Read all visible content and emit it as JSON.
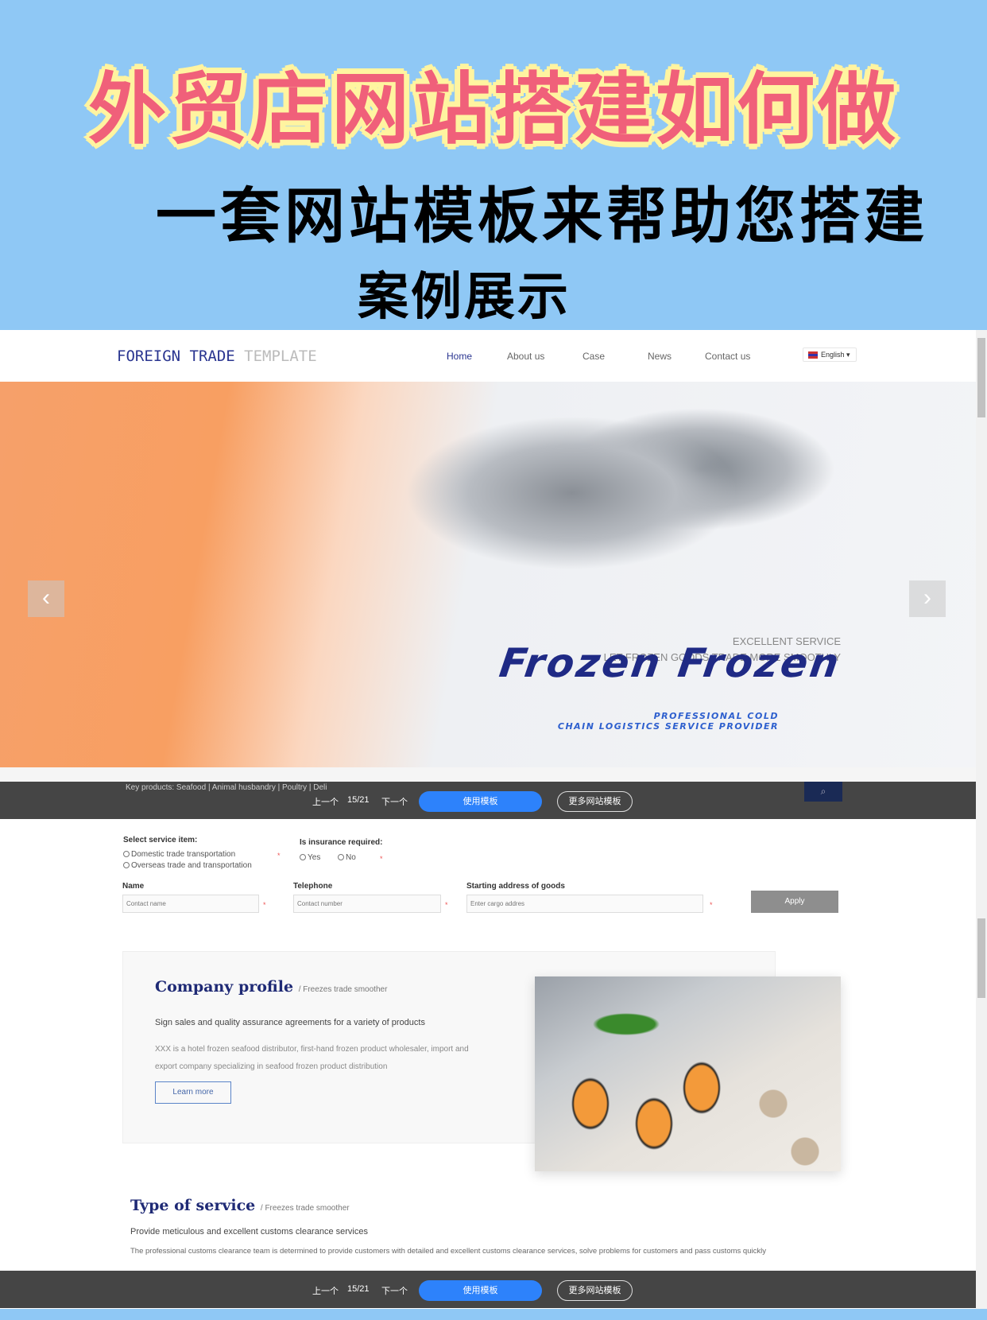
{
  "poster": {
    "title": "外贸店网站搭建如何做",
    "subtitle": "一套网站模板来帮助您搭建",
    "caption": "案例展示"
  },
  "header": {
    "logo_main": "FOREIGN TRADE",
    "logo_sub": "TEMPLATE",
    "nav": [
      "Home",
      "About us",
      "Case",
      "News",
      "Contact us"
    ],
    "language": "English"
  },
  "banner": {
    "line1": "EXCELLENT SERVICE",
    "line2": "LET FROZEN GOODS TRADE MORE SMOOTHLY",
    "headline": "Frozen Frozen",
    "tag1": "PROFESSIONAL COLD",
    "tag2": "CHAIN LOGISTICS SERVICE PROVIDER",
    "prev": "‹",
    "next": "›"
  },
  "key_products": "Key products:   Seafood  |  Animal husbandry  |  Poultry  |  Deli",
  "preview_bar": {
    "prev": "上一个",
    "page": "15/21",
    "next": "下一个",
    "use": "使用模板",
    "more": "更多网站模板"
  },
  "form": {
    "service_label": "Select service item:",
    "service_options": [
      "Domestic trade transportation",
      "Overseas trade and transportation"
    ],
    "insurance_label": "Is insurance required:",
    "insurance_options": [
      "Yes",
      "No"
    ],
    "name_label": "Name",
    "name_placeholder": "Contact name",
    "tel_label": "Telephone",
    "tel_placeholder": "Contact number",
    "addr_label": "Starting address of goods",
    "addr_placeholder": "Enter cargo addres",
    "required": "*",
    "apply": "Apply"
  },
  "company": {
    "title": "Company profile",
    "sub": "/ Freezes trade smoother",
    "lead": "Sign sales and quality assurance agreements for a variety of products",
    "body": "XXX is a hotel frozen seafood distributor, first-hand frozen product wholesaler, import and export company specializing in seafood frozen product distribution",
    "button": "Learn more"
  },
  "service": {
    "title": "Type of service",
    "sub": "/ Freezes trade smoother",
    "lead": "Provide meticulous and excellent customs clearance services",
    "body": "The professional customs clearance team is determined to provide customers with detailed and excellent customs clearance services, solve problems for customers and pass customs quickly"
  },
  "colors": {
    "background": "#8fc8f5",
    "title_pink": "#f0607a",
    "title_outline": "#fff4a0",
    "brand_navy": "#1f2a85",
    "accent_blue": "#2d82fb"
  }
}
